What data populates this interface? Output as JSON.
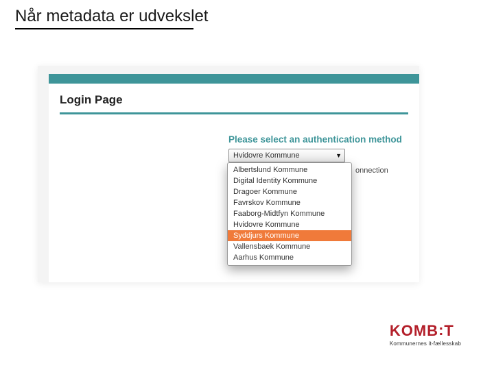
{
  "slide": {
    "title": "Når metadata er udvekslet"
  },
  "page": {
    "heading": "Login Page",
    "auth_prompt": "Please select an authentication method",
    "selected_value": "Hvidovre Kommune",
    "side_text": "onnection",
    "options": [
      "Albertslund Kommune",
      "Digital Identity Kommune",
      "Dragoer Kommune",
      "Favrskov Kommune",
      "Faaborg-Midtfyn Kommune",
      "Hvidovre Kommune",
      "Syddjurs Kommune",
      "Vallensbaek Kommune",
      "Aarhus Kommune"
    ],
    "highlight_index": 6
  },
  "footer": {
    "brand": "KOMB:T",
    "tagline": "Kommunernes it-fællesskab"
  }
}
